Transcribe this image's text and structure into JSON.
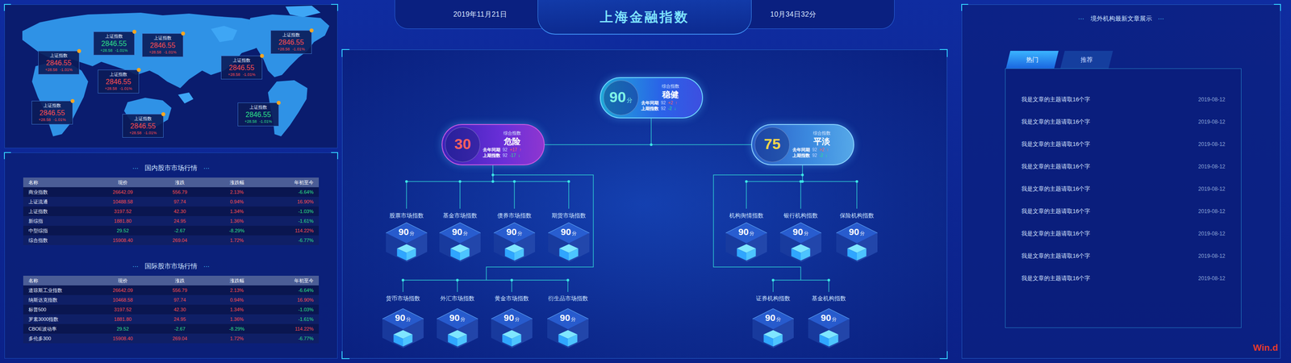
{
  "header": {
    "date": "2019年11月21日",
    "title": "上海金融指数",
    "time": "10月34日32分"
  },
  "map": {
    "markers": [
      {
        "name": "上证指数",
        "value": "2846.55",
        "change": "+28.58",
        "percent": "-1.01%",
        "trend": "down"
      },
      {
        "name": "上证指数",
        "value": "2846.55",
        "change": "+28.58",
        "percent": "-1.01%",
        "trend": "up"
      },
      {
        "name": "上证指数",
        "value": "2846.55",
        "change": "+28.58",
        "percent": "-1.01%",
        "trend": "up"
      },
      {
        "name": "上证指数",
        "value": "2846.55",
        "change": "+28.58",
        "percent": "-1.01%",
        "trend": "up"
      },
      {
        "name": "上证指数",
        "value": "2846.55",
        "change": "+28.58",
        "percent": "-1.01%",
        "trend": "up"
      },
      {
        "name": "上证指数",
        "value": "2846.55",
        "change": "+28.58",
        "percent": "-1.01%",
        "trend": "up"
      },
      {
        "name": "上证指数",
        "value": "2846.55",
        "change": "+28.58",
        "percent": "-1.01%",
        "trend": "up"
      },
      {
        "name": "上证指数",
        "value": "2846.55",
        "change": "+28.58",
        "percent": "-1.01%",
        "trend": "up"
      },
      {
        "name": "上证指数",
        "value": "2846.55",
        "change": "+28.58",
        "percent": "-1.01%",
        "trend": "down"
      }
    ]
  },
  "domestic": {
    "title": "国内股市市场行情",
    "decor_left": "···",
    "decor_right": "···",
    "columns": [
      "名称",
      "现价",
      "涨跌",
      "涨跌幅",
      "年初至今"
    ],
    "rows": [
      {
        "cells": [
          "商业指数",
          "26642.09",
          "556.79",
          "2.13%",
          "-6.64%"
        ],
        "trend": "up",
        "ytd_trend": "down"
      },
      {
        "cells": [
          "上证流通",
          "10488.58",
          "97.74",
          "0.94%",
          "16.90%"
        ],
        "trend": "up",
        "ytd_trend": "up"
      },
      {
        "cells": [
          "上证指数",
          "3197.52",
          "42.30",
          "1.34%",
          "-1.03%"
        ],
        "trend": "up",
        "ytd_trend": "down"
      },
      {
        "cells": [
          "新综指",
          "1881.80",
          "24.95",
          "1.36%",
          "-1.61%"
        ],
        "trend": "up",
        "ytd_trend": "down"
      },
      {
        "cells": [
          "中型综指",
          "29.52",
          "-2.67",
          "-8.29%",
          "114.22%"
        ],
        "trend": "down",
        "ytd_trend": "up"
      },
      {
        "cells": [
          "综合指数",
          "15908.40",
          "269.04",
          "1.72%",
          "-6.77%"
        ],
        "trend": "up",
        "ytd_trend": "down"
      }
    ]
  },
  "international": {
    "title": "国际股市市场行情",
    "decor_left": "···",
    "decor_right": "···",
    "columns": [
      "名称",
      "现价",
      "涨跌",
      "涨跌幅",
      "年初至今"
    ],
    "rows": [
      {
        "cells": [
          "道琼斯工业指数",
          "26642.09",
          "556.79",
          "2.13%",
          "-6.64%"
        ],
        "trend": "up",
        "ytd_trend": "down"
      },
      {
        "cells": [
          "纳斯达克指数",
          "10468.58",
          "97.74",
          "0.94%",
          "16.90%"
        ],
        "trend": "up",
        "ytd_trend": "up"
      },
      {
        "cells": [
          "标普500",
          "3197.52",
          "42.30",
          "1.34%",
          "-1.03%"
        ],
        "trend": "up",
        "ytd_trend": "down"
      },
      {
        "cells": [
          "罗素3000指数",
          "1881.80",
          "24.95",
          "1.36%",
          "-1.61%"
        ],
        "trend": "up",
        "ytd_trend": "down"
      },
      {
        "cells": [
          "CBOE波动率",
          "29.52",
          "-2.67",
          "-8.29%",
          "114.22%"
        ],
        "trend": "down",
        "ytd_trend": "up"
      },
      {
        "cells": [
          "多伦多300",
          "15908.40",
          "269.04",
          "1.72%",
          "-6.77%"
        ],
        "trend": "up",
        "ytd_trend": "down"
      }
    ]
  },
  "composite": [
    {
      "score": "90",
      "unit": "分",
      "label": "综合指数",
      "status": "稳健",
      "kind": "steady",
      "last_year_label": "去年同期",
      "last_year_value": "92",
      "last_year_change": "+2",
      "last_year_arrow": "↑",
      "prev_label": "上期指数",
      "prev_value": "92",
      "prev_change": "-2",
      "prev_arrow": "↓"
    },
    {
      "score": "30",
      "unit": "",
      "label": "综合指数",
      "status": "危险",
      "kind": "danger",
      "last_year_label": "去年同期",
      "last_year_value": "92",
      "last_year_change": "+17",
      "last_year_arrow": "↑",
      "prev_label": "上期指数",
      "prev_value": "92",
      "prev_change": "-17",
      "prev_arrow": "↓"
    },
    {
      "score": "75",
      "unit": "",
      "label": "综合指数",
      "status": "平淡",
      "kind": "flat",
      "last_year_label": "去年同期",
      "last_year_value": "92",
      "last_year_change": "+2",
      "last_year_arrow": "↑",
      "prev_label": "上期指数",
      "prev_value": "92",
      "prev_change": "-2",
      "prev_arrow": "↓"
    }
  ],
  "index_groups": [
    {
      "rows": [
        [
          {
            "label": "股票市场指数",
            "score": "90",
            "unit": "分"
          },
          {
            "label": "基金市场指数",
            "score": "90",
            "unit": "分"
          },
          {
            "label": "债券市场指数",
            "score": "90",
            "unit": "分"
          },
          {
            "label": "期货市场指数",
            "score": "90",
            "unit": "分"
          }
        ],
        [
          {
            "label": "货币市场指数",
            "score": "90",
            "unit": "分"
          },
          {
            "label": "外汇市场指数",
            "score": "90",
            "unit": "分"
          },
          {
            "label": "黄金市场指数",
            "score": "90",
            "unit": "分"
          },
          {
            "label": "衍生品市场指数",
            "score": "90",
            "unit": "分"
          }
        ]
      ]
    },
    {
      "rows": [
        [
          {
            "label": "机构舆情指数",
            "score": "90",
            "unit": "分"
          },
          {
            "label": "银行机构指数",
            "score": "90",
            "unit": "分"
          },
          {
            "label": "保险机构指数",
            "score": "90",
            "unit": "分"
          }
        ],
        [
          {
            "label": "证券机构指数",
            "score": "90",
            "unit": "分"
          },
          {
            "label": "基金机构指数",
            "score": "90",
            "unit": "分"
          }
        ]
      ]
    }
  ],
  "articles": {
    "title": "境外机构最新文章展示",
    "decor_left": "···",
    "decor_right": "···",
    "tabs": [
      {
        "label": "热门",
        "selected": true
      },
      {
        "label": "推荐",
        "selected": false
      }
    ],
    "items": [
      {
        "title": "我是文章的主题请取16个字",
        "date": "2019-08-12"
      },
      {
        "title": "我是文章的主题请取16个字",
        "date": "2019-08-12"
      },
      {
        "title": "我是文章的主题请取16个字",
        "date": "2019-08-12"
      },
      {
        "title": "我是文章的主题请取16个字",
        "date": "2019-08-12"
      },
      {
        "title": "我是文章的主题请取16个字",
        "date": "2019-08-12"
      },
      {
        "title": "我是文章的主题请取16个字",
        "date": "2019-08-12"
      },
      {
        "title": "我是文章的主题请取16个字",
        "date": "2019-08-12"
      },
      {
        "title": "我是文章的主题请取16个字",
        "date": "2019-08-12"
      },
      {
        "title": "我是文章的主题请取16个字",
        "date": "2019-08-12"
      }
    ]
  },
  "watermark": "Win.d"
}
